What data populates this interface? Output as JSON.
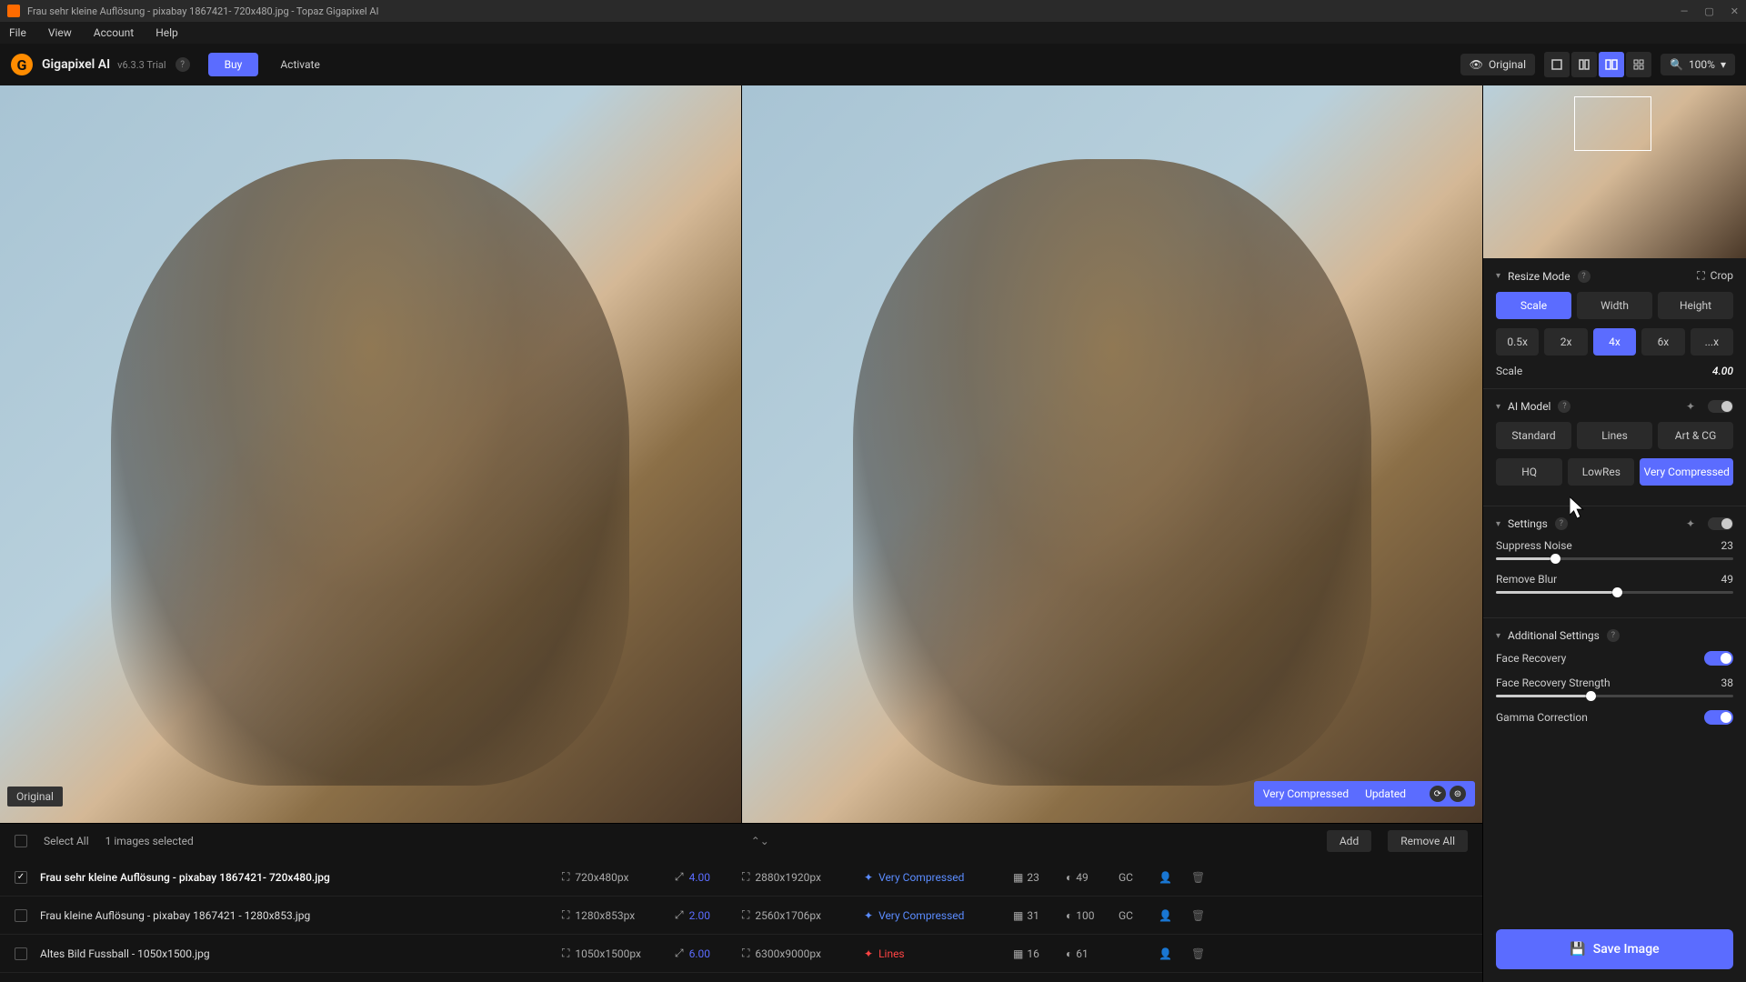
{
  "window": {
    "title": "Frau sehr kleine Auflösung - pixabay 1867421- 720x480.jpg - Topaz Gigapixel AI"
  },
  "menubar": {
    "items": [
      "File",
      "View",
      "Account",
      "Help"
    ]
  },
  "app": {
    "name": "Gigapixel AI",
    "version": "v6.3.3 Trial",
    "buy": "Buy",
    "activate": "Activate"
  },
  "toolbar": {
    "original": "Original",
    "zoom": "100%"
  },
  "preview": {
    "original_label": "Original",
    "status_model": "Very Compressed",
    "status_updated": "Updated"
  },
  "filestrip": {
    "select_all": "Select All",
    "selected_count": "1 images selected",
    "add": "Add",
    "remove_all": "Remove All",
    "rows": [
      {
        "selected": true,
        "name": "Frau sehr kleine Auflösung - pixabay 1867421- 720x480.jpg",
        "in_dim": "720x480px",
        "scale": "4.00",
        "out_dim": "2880x1920px",
        "model": "Very Compressed",
        "model_class": "vc",
        "noise": "23",
        "blur": "49",
        "gc": "GC"
      },
      {
        "selected": false,
        "name": "Frau kleine Auflösung - pixabay 1867421 - 1280x853.jpg",
        "in_dim": "1280x853px",
        "scale": "2.00",
        "out_dim": "2560x1706px",
        "model": "Very Compressed",
        "model_class": "vc",
        "noise": "31",
        "blur": "100",
        "gc": "GC"
      },
      {
        "selected": false,
        "name": "Altes Bild Fussball - 1050x1500.jpg",
        "in_dim": "1050x1500px",
        "scale": "6.00",
        "out_dim": "6300x9000px",
        "model": "Lines",
        "model_class": "lines",
        "noise": "16",
        "blur": "61",
        "gc": ""
      }
    ]
  },
  "sidebar": {
    "resize_mode": {
      "label": "Resize Mode",
      "crop": "Crop",
      "modes": [
        "Scale",
        "Width",
        "Height"
      ],
      "presets": [
        "0.5x",
        "2x",
        "4x",
        "6x",
        "...x"
      ],
      "scale_label": "Scale",
      "scale_value": "4.00"
    },
    "ai_model": {
      "label": "AI Model",
      "row1": [
        "Standard",
        "Lines",
        "Art & CG"
      ],
      "row2": [
        "HQ",
        "LowRes",
        "Very Compressed"
      ]
    },
    "settings": {
      "label": "Settings",
      "suppress_noise": "Suppress Noise",
      "suppress_noise_val": "23",
      "remove_blur": "Remove Blur",
      "remove_blur_val": "49"
    },
    "additional": {
      "label": "Additional Settings",
      "face_recovery": "Face Recovery",
      "face_strength": "Face Recovery Strength",
      "face_strength_val": "38",
      "gamma": "Gamma Correction"
    },
    "save": "Save Image"
  }
}
